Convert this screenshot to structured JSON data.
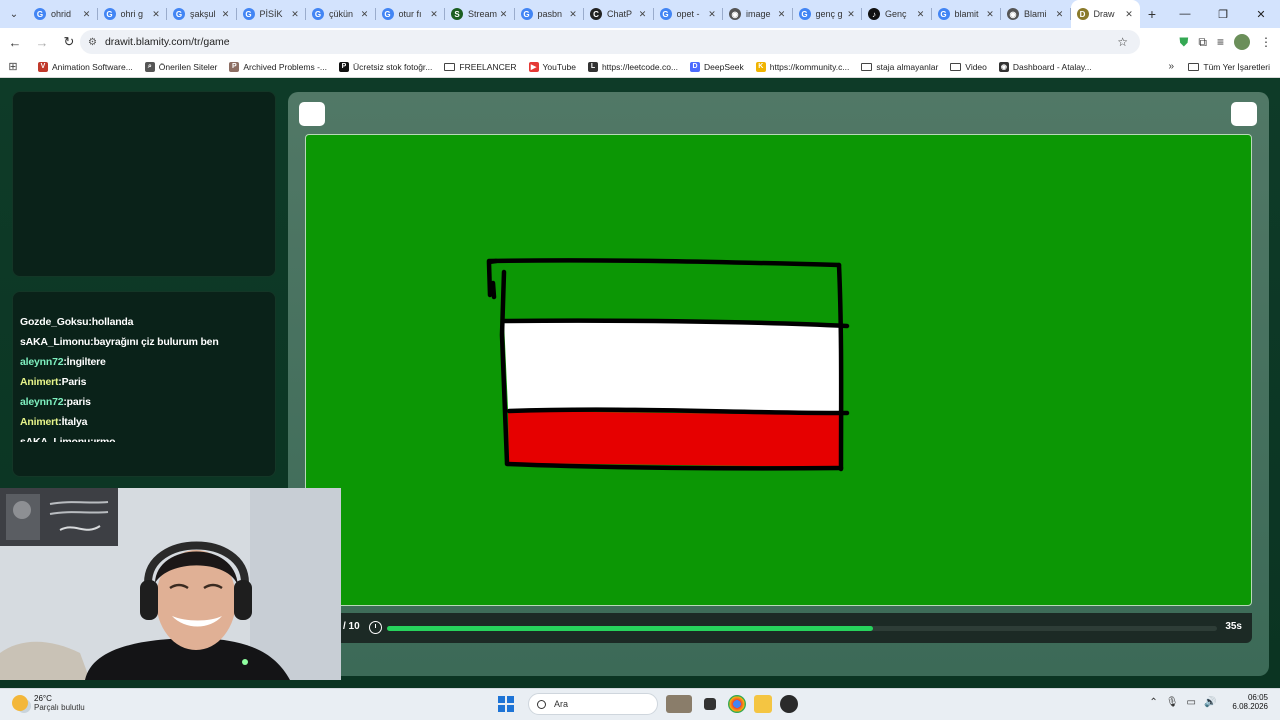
{
  "browser": {
    "tabs": [
      {
        "label": "ohrid",
        "color": "#4285f4",
        "letter": "G"
      },
      {
        "label": "ohri g",
        "color": "#4285f4",
        "letter": "G"
      },
      {
        "label": "şakşul",
        "color": "#4285f4",
        "letter": "G"
      },
      {
        "label": "PİSİK",
        "color": "#4285f4",
        "letter": "G"
      },
      {
        "label": "çükün",
        "color": "#4285f4",
        "letter": "G"
      },
      {
        "label": "otur fı",
        "color": "#4285f4",
        "letter": "G"
      },
      {
        "label": "Stream",
        "color": "#1b5e20",
        "letter": "S"
      },
      {
        "label": "pasbn",
        "color": "#4285f4",
        "letter": "G"
      },
      {
        "label": "ChatP",
        "color": "#222222",
        "letter": "C"
      },
      {
        "label": "opet -",
        "color": "#4285f4",
        "letter": "G"
      },
      {
        "label": "image",
        "color": "#555555",
        "letter": "◉"
      },
      {
        "label": "genç g",
        "color": "#4285f4",
        "letter": "G"
      },
      {
        "label": "Genç",
        "color": "#111111",
        "letter": "♪"
      },
      {
        "label": "blamit",
        "color": "#4285f4",
        "letter": "G"
      },
      {
        "label": "Blami",
        "color": "#555555",
        "letter": "◉"
      },
      {
        "label": "Draw",
        "color": "#8a7a2a",
        "letter": "D",
        "active": true
      }
    ],
    "url": "drawit.blamity.com/tr/game",
    "bookmarks": [
      {
        "label": "Animation Software...",
        "type": "icon",
        "color": "#c0392b",
        "letter": "V"
      },
      {
        "label": "Önerilen Siteler",
        "type": "icon",
        "color": "#555555",
        "letter": "⌕"
      },
      {
        "label": "Archived Problems -...",
        "type": "icon",
        "color": "#8d6e63",
        "letter": "P"
      },
      {
        "label": "Ücretsiz stok fotoğr...",
        "type": "icon",
        "color": "#111111",
        "letter": "P"
      },
      {
        "label": "FREELANCER",
        "type": "folder"
      },
      {
        "label": "YouTube",
        "type": "icon",
        "color": "#e53935",
        "letter": "▶"
      },
      {
        "label": "https://leetcode.co...",
        "type": "icon",
        "color": "#333333",
        "letter": "L"
      },
      {
        "label": "DeepSeek",
        "type": "icon",
        "color": "#4d6bfe",
        "letter": "D"
      },
      {
        "label": "https://kommunity.c...",
        "type": "icon",
        "color": "#f0b400",
        "letter": "K"
      },
      {
        "label": "staja almayanlar",
        "type": "folder"
      },
      {
        "label": "Video",
        "type": "folder"
      },
      {
        "label": "Dashboard - Atalay...",
        "type": "icon",
        "color": "#333333",
        "letter": "◉"
      }
    ],
    "all_bookmarks_label": "Tüm Yer İşaretleri",
    "more_label": "»"
  },
  "chat": {
    "messages": [
      {
        "user": "Gozde_Goksu",
        "text": "hollanda",
        "color": "white"
      },
      {
        "user": "sAKA_Limonu",
        "text": "bayrağını çiz bulurum ben",
        "color": "white"
      },
      {
        "user": "aleynn72",
        "text": "İngiltere",
        "color": "green"
      },
      {
        "user": "Animert",
        "text": "Paris",
        "color": "yellow"
      },
      {
        "user": "aleynn72",
        "text": "paris",
        "color": "green"
      },
      {
        "user": "Animert",
        "text": "İtalya",
        "color": "yellow"
      },
      {
        "user": "sAKA_Limonu",
        "text": "ırmo",
        "color": "white"
      }
    ]
  },
  "game": {
    "round_text": "/ 10",
    "time_left": "35s",
    "progress_fraction": 0.585,
    "canvas_bg": "#0c9705",
    "drawing_colors": {
      "stroke": "#000000",
      "top": "#0c9705",
      "middle": "#ffffff",
      "bottom": "#e60000"
    }
  },
  "taskbar": {
    "temperature": "26°C",
    "condition": "Parçalı bulutlu",
    "search_label": "Ara",
    "time": "06:05",
    "date": "6.08.2026"
  }
}
